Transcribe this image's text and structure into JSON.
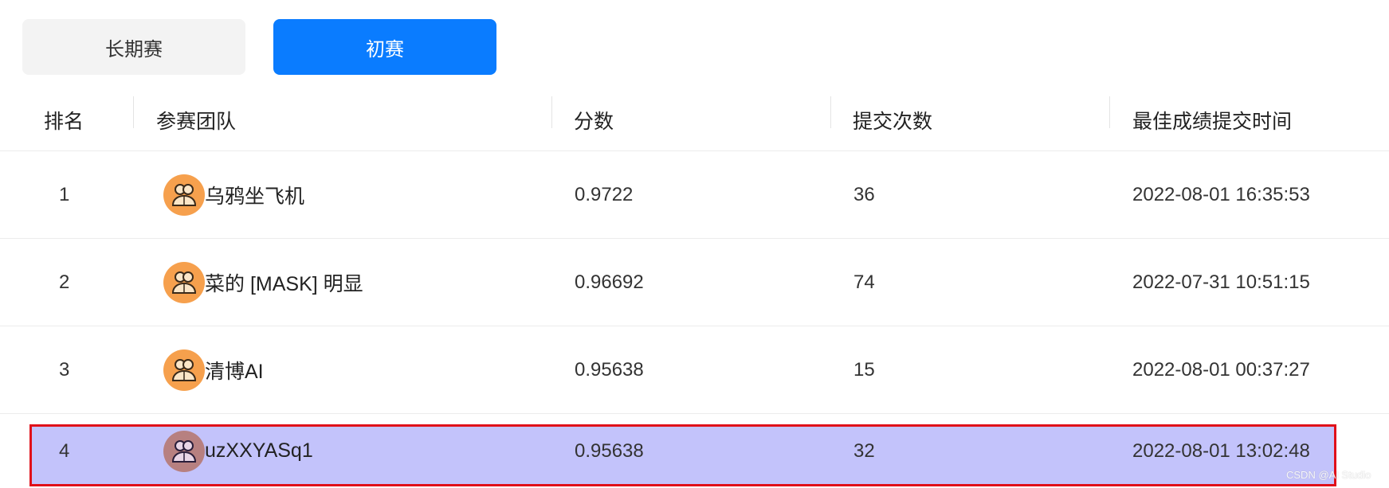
{
  "tabs": [
    {
      "label": "长期赛",
      "active": false
    },
    {
      "label": "初赛",
      "active": true
    }
  ],
  "columns": [
    "排名",
    "参赛团队",
    "分数",
    "提交次数",
    "最佳成绩提交时间"
  ],
  "rows": [
    {
      "rank": "1",
      "team": "乌鸦坐飞机",
      "score": "0.9722",
      "submissions": "36",
      "best_time": "2022-08-01 16:35:53"
    },
    {
      "rank": "2",
      "team": "菜的 [MASK] 明显",
      "score": "0.96692",
      "submissions": "74",
      "best_time": "2022-07-31 10:51:15"
    },
    {
      "rank": "3",
      "team": "清博AI",
      "score": "0.95638",
      "submissions": "15",
      "best_time": "2022-08-01 00:37:27"
    },
    {
      "rank": "4",
      "team": "uzXXYASq1",
      "score": "0.95638",
      "submissions": "32",
      "best_time": "2022-08-01 13:02:48",
      "highlighted": true
    }
  ],
  "watermark": "CSDN @AI Studio",
  "icons": {
    "avatar": "team-avatar-icon"
  },
  "colors": {
    "active_tab": "#0a7cff",
    "avatar": "#f6a04d",
    "highlight_fill": "#c3c3fb",
    "highlight_border": "#e0101a"
  }
}
